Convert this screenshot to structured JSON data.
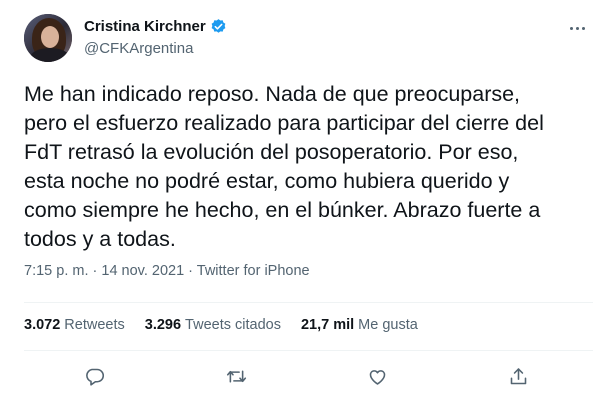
{
  "tweet": {
    "author_name": "Cristina Kirchner",
    "author_handle": "@CFKArgentina",
    "body": "Me han indicado reposo. Nada de que preocuparse,\npero el esfuerzo realizado para participar del cierre del\nFdT retrasó la evolución del posoperatorio. Por eso,\nesta noche no podré estar, como hubiera querido y\ncomo siempre he hecho, en el búnker. Abrazo fuerte a\ntodos y a todas.",
    "time": "7:15 p. m.",
    "separator": " · ",
    "date": "14 nov. 2021",
    "source": "Twitter for iPhone"
  },
  "stats": {
    "retweets_count": "3.072",
    "retweets_label": "Retweets",
    "quotes_count": "3.296",
    "quotes_label": "Tweets citados",
    "likes_count": "21,7 mil",
    "likes_label": "Me gusta"
  },
  "icons": {
    "verified": "verified-badge-icon",
    "more": "more-options-icon",
    "reply": "reply-icon",
    "retweet": "retweet-icon",
    "like": "heart-icon",
    "share": "share-icon"
  },
  "colors": {
    "verified": "#1d9bf0",
    "secondary_text": "#536471",
    "primary_text": "#0f1419",
    "divider": "#eff3f4"
  }
}
